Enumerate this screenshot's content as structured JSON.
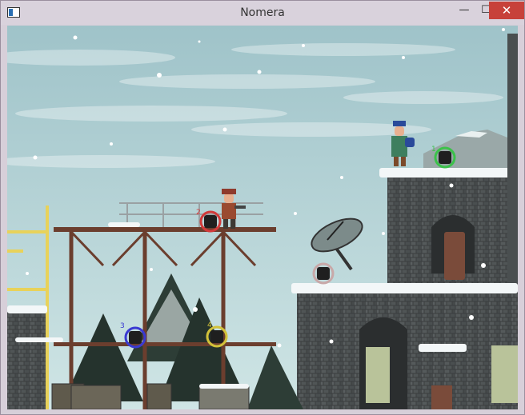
{
  "window": {
    "title": "Nomera",
    "min_glyph": "—",
    "max_glyph": "☐",
    "close_glyph": "✕"
  },
  "hud": {
    "bomb_labels": [
      "1",
      "2",
      "3",
      "4"
    ]
  },
  "colors": {
    "sky_top": "#9fc3c9",
    "sky_bottom": "#c8e1e2",
    "stone": "#3b3e3f",
    "snow": "#f3f7f8",
    "scaffold": "#6b3e2e",
    "crane": "#e8d25a",
    "marker_green": "#3bc24a",
    "marker_red": "#d23a3a",
    "marker_blue": "#3a3ad2",
    "marker_yellow": "#d2c23a",
    "marker_grey": "#c8a8a8"
  },
  "icons": {
    "app": "window-icon",
    "minimize": "minimize-icon",
    "maximize": "maximize-icon",
    "close": "close-icon"
  }
}
